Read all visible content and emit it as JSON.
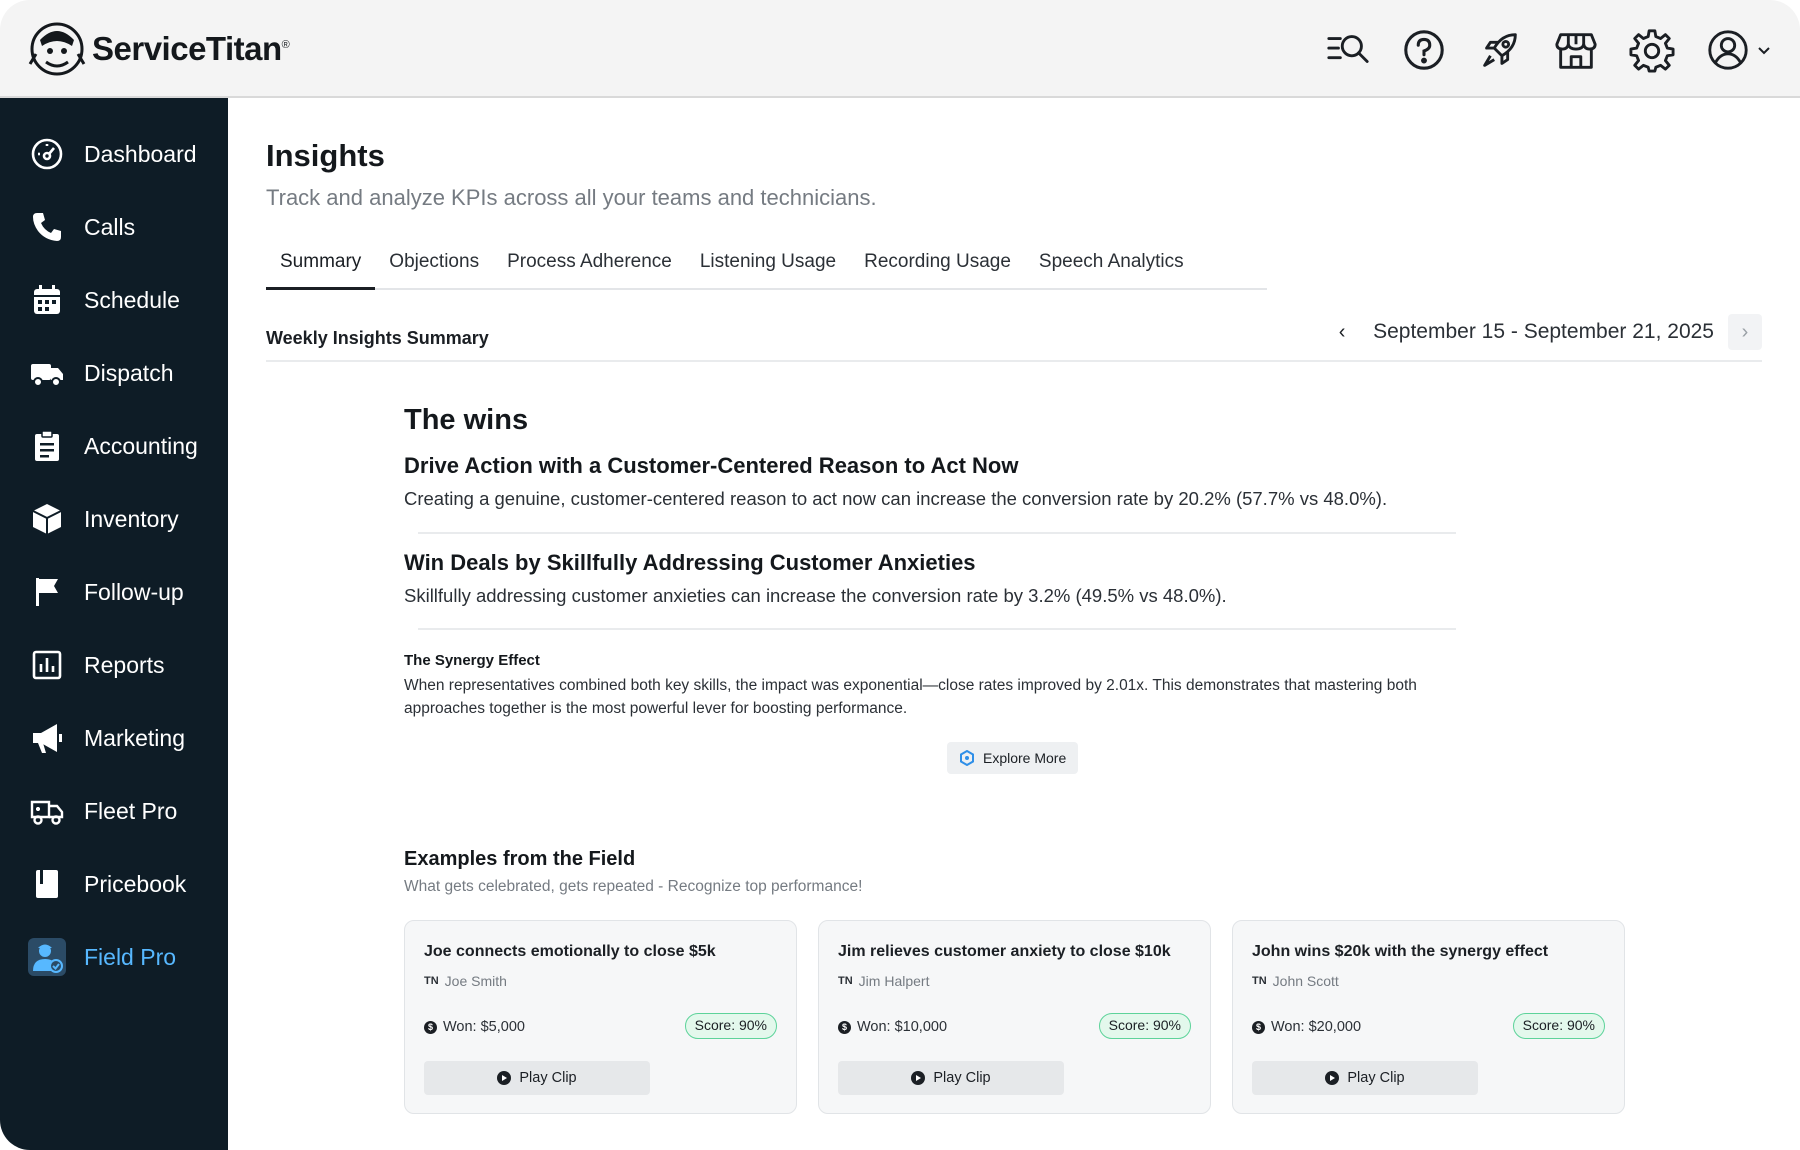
{
  "header": {
    "brand": "ServiceTitan",
    "brand_mark": "®",
    "icons": [
      "search-list-icon",
      "help-icon",
      "rocket-icon",
      "store-icon",
      "gear-icon",
      "account-icon"
    ]
  },
  "sidebar": {
    "items": [
      {
        "label": "Dashboard",
        "icon": "dashboard-icon"
      },
      {
        "label": "Calls",
        "icon": "phone-icon"
      },
      {
        "label": "Schedule",
        "icon": "calendar-icon"
      },
      {
        "label": "Dispatch",
        "icon": "truck-icon"
      },
      {
        "label": "Accounting",
        "icon": "clipboard-icon"
      },
      {
        "label": "Inventory",
        "icon": "box-icon"
      },
      {
        "label": "Follow-up",
        "icon": "flag-icon"
      },
      {
        "label": "Reports",
        "icon": "bar-chart-icon"
      },
      {
        "label": "Marketing",
        "icon": "megaphone-icon"
      },
      {
        "label": "Fleet Pro",
        "icon": "fleet-truck-icon"
      },
      {
        "label": "Pricebook",
        "icon": "book-icon"
      },
      {
        "label": "Field Pro",
        "icon": "technician-icon",
        "active": true
      }
    ],
    "active_color": "#57b8ff"
  },
  "page": {
    "title": "Insights",
    "subtitle": "Track and analyze KPIs across all your teams and technicians."
  },
  "tabs": [
    {
      "label": "Summary",
      "active": true
    },
    {
      "label": "Objections"
    },
    {
      "label": "Process Adherence"
    },
    {
      "label": "Listening Usage"
    },
    {
      "label": "Recording Usage"
    },
    {
      "label": "Speech Analytics"
    }
  ],
  "summary": {
    "title": "Weekly Insights Summary",
    "date_range": "September 15 - September 21, 2025",
    "prev_glyph": "‹",
    "next_glyph": "›"
  },
  "wins": {
    "heading": "The wins",
    "items": [
      {
        "title": "Drive Action with a Customer-Centered Reason to Act Now",
        "text": "Creating a genuine, customer-centered reason to act now can increase the conversion rate by 20.2% (57.7% vs 48.0%)."
      },
      {
        "title": "Win Deals by Skillfully Addressing Customer Anxieties",
        "text": "Skillfully addressing customer anxieties can increase the conversion rate by 3.2% (49.5% vs 48.0%)."
      }
    ],
    "synergy": {
      "title": "The Synergy Effect",
      "text": "When representatives combined both key skills, the impact was exponential—close rates improved by 2.01x. This demonstrates that mastering both approaches together is the most powerful lever for boosting performance."
    },
    "explore_label": "Explore More"
  },
  "examples": {
    "heading": "Examples from the Field",
    "subtitle": "What gets celebrated, gets repeated - Recognize top performance!",
    "cards": [
      {
        "title": "Joe connects emotionally to close $5k",
        "tn": "TN",
        "user": "Joe Smith",
        "won": "Won: $5,000",
        "score": "Score: 90%",
        "play": "Play Clip"
      },
      {
        "title": "Jim relieves customer anxiety to close $10k",
        "tn": "TN",
        "user": "Jim Halpert",
        "won": "Won: $10,000",
        "score": "Score: 90%",
        "play": "Play Clip"
      },
      {
        "title": "John wins $20k with the synergy effect",
        "tn": "TN",
        "user": "John Scott",
        "won": "Won: $20,000",
        "score": "Score: 90%",
        "play": "Play Clip"
      }
    ],
    "score_color": "#5dd39a"
  }
}
